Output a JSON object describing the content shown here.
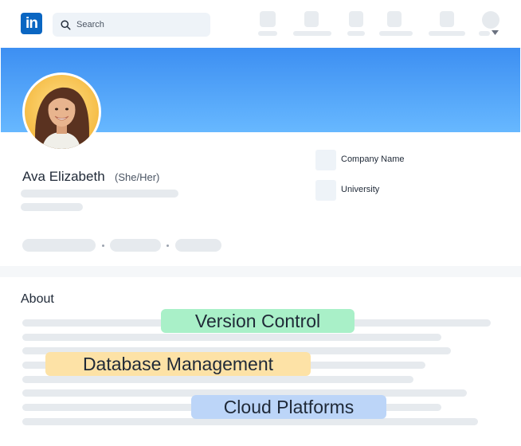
{
  "header": {
    "logo_text": "in",
    "search_placeholder": "Search",
    "nav_items": 5
  },
  "profile": {
    "name": "Ava Elizabeth",
    "pronouns": "(She/Her)",
    "company": "Company Name",
    "school": "University"
  },
  "about": {
    "title": "About",
    "skills": [
      {
        "label": "Version Control",
        "color": "#a9f0c8"
      },
      {
        "label": "Database Management",
        "color": "#fde2a6"
      },
      {
        "label": "Cloud Platforms",
        "color": "#bcd5f8"
      }
    ]
  },
  "colors": {
    "brand": "#0a66c2",
    "banner_top": "#3d8ff2",
    "banner_bottom": "#67b8ff"
  }
}
